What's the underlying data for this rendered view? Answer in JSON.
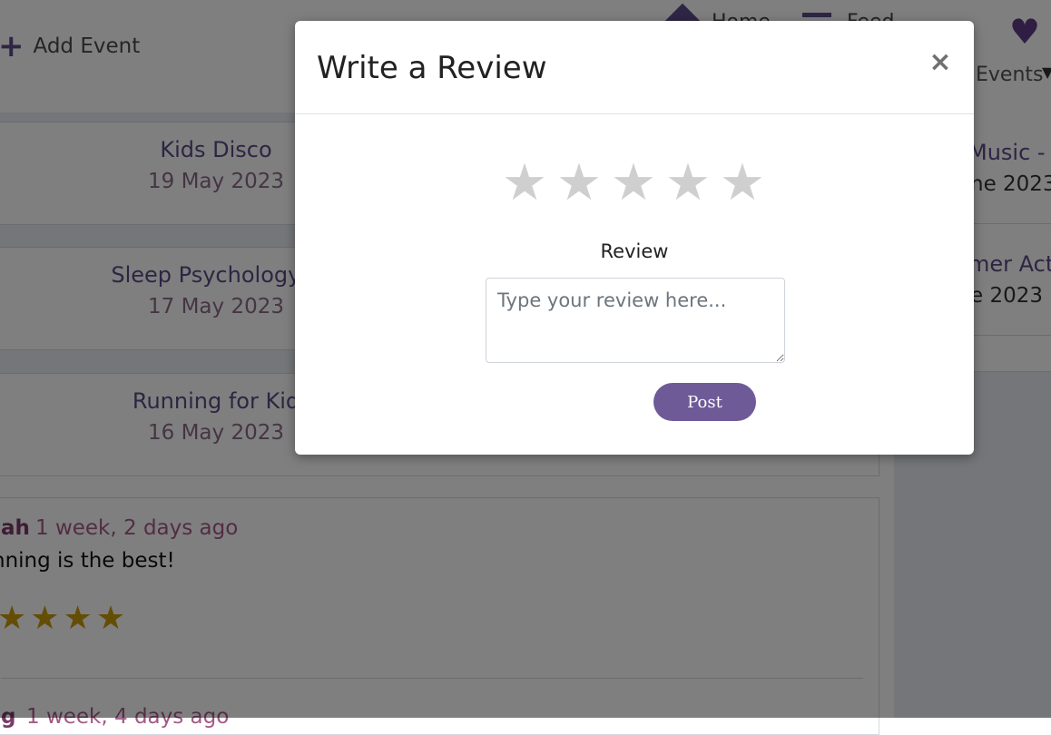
{
  "header": {
    "add_event_label": "Add Event",
    "nav_home_label": "Home",
    "nav_feed_label": "Feed",
    "events_dropdown_label": "Events"
  },
  "events_list": [
    {
      "title": "Kids Disco",
      "date": "19 May 2023"
    },
    {
      "title": "Sleep Psychology T",
      "date": "17 May 2023"
    },
    {
      "title": "Running for Kid",
      "date": "16 May 2023"
    }
  ],
  "upcoming_events": [
    {
      "title": "Music - T",
      "date": "ne 2023"
    },
    {
      "title": "mer Act",
      "date": "e 2023"
    }
  ],
  "reviews": [
    {
      "user": "ah",
      "time": "1 week, 2 days ago",
      "text": "nning is the best!",
      "stars": "★★★★"
    },
    {
      "user": "g",
      "time": "1 week, 4 days ago"
    }
  ],
  "modal": {
    "title": "Write a Review",
    "close_symbol": "×",
    "rating_symbol": "★",
    "review_label": "Review",
    "review_placeholder": "Type your review here...",
    "post_button_label": "Post",
    "rating_value": 0,
    "rating_max": 5
  },
  "colors": {
    "accent": "#6f5a98",
    "star_empty": "#cfcfcf",
    "star_filled": "#c89a0a",
    "heart": "#5e3a86"
  }
}
